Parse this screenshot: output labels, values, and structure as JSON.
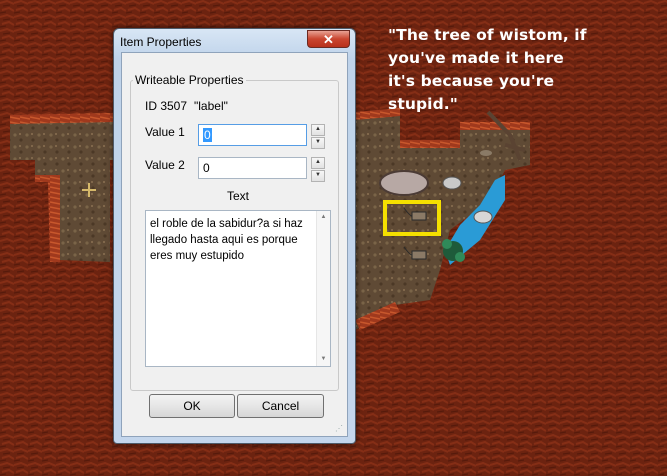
{
  "annotation": {
    "text": "\"The tree of wistom, if\nyou've made it here\nit's because you're\nstupid.\""
  },
  "dialog": {
    "title": "Item Properties",
    "close_glyph": "✕",
    "group_title": "Writeable Properties",
    "id_label": "ID 3507",
    "id_value": "\"label\"",
    "value1_label": "Value 1",
    "value1": "0",
    "value2_label": "Value 2",
    "value2": "0",
    "text_label": "Text",
    "text_value": "el roble de la sabidur?a si haz llegado hasta aqui es porque eres muy estupido",
    "ok_label": "OK",
    "cancel_label": "Cancel"
  },
  "colors": {
    "highlight": "#f5e000",
    "close_button": "#c9452f",
    "map_ground": "#6e2410",
    "water": "#2a9bd6"
  },
  "icons": {
    "spin_up": "▲",
    "spin_down": "▼",
    "scroll_up": "▲",
    "scroll_down": "▼",
    "grip": "⋰"
  }
}
